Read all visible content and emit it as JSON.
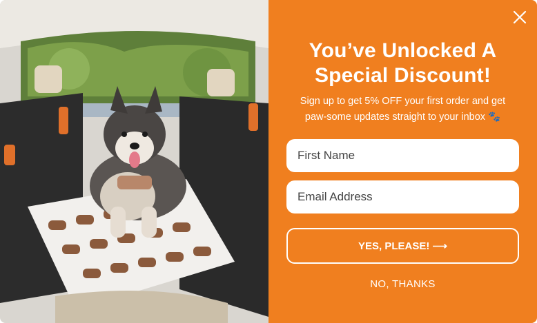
{
  "popup": {
    "headline_line1": "You’ve Unlocked A",
    "headline_line2": "Special Discount!",
    "subtext": "Sign up to get 5% OFF your first order and get paw-some updates straight to your inbox 🐾",
    "first_name_placeholder": "First Name",
    "email_placeholder": "Email Address",
    "cta_label": "YES, PLEASE! ⟶",
    "decline_label": "NO, THANKS",
    "close_icon": "close-icon",
    "accent_color": "#f07f1f"
  },
  "image": {
    "subject": "dog-on-car-seat-cover-photo"
  }
}
